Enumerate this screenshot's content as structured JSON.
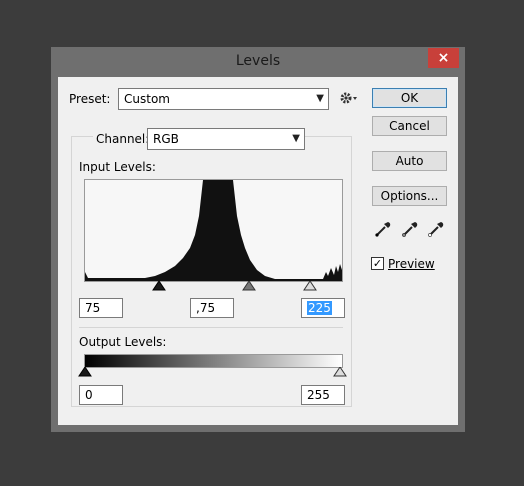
{
  "window": {
    "title": "Levels",
    "close_glyph": "×"
  },
  "preset": {
    "label": "Preset:",
    "value": "Custom",
    "settings_icon": "gear-icon"
  },
  "channel": {
    "label": "Channel:",
    "value": "RGB"
  },
  "input_levels": {
    "label": "Input Levels:",
    "black": "75",
    "gamma": ",75",
    "white": "225"
  },
  "output_levels": {
    "label": "Output Levels:",
    "black": "0",
    "white": "255"
  },
  "buttons": {
    "ok": "OK",
    "cancel": "Cancel",
    "auto": "Auto",
    "options": "Options..."
  },
  "eyedroppers": [
    "eyedropper-black-icon",
    "eyedropper-gray-icon",
    "eyedropper-white-icon"
  ],
  "preview": {
    "label": "Preview",
    "checked": true
  }
}
